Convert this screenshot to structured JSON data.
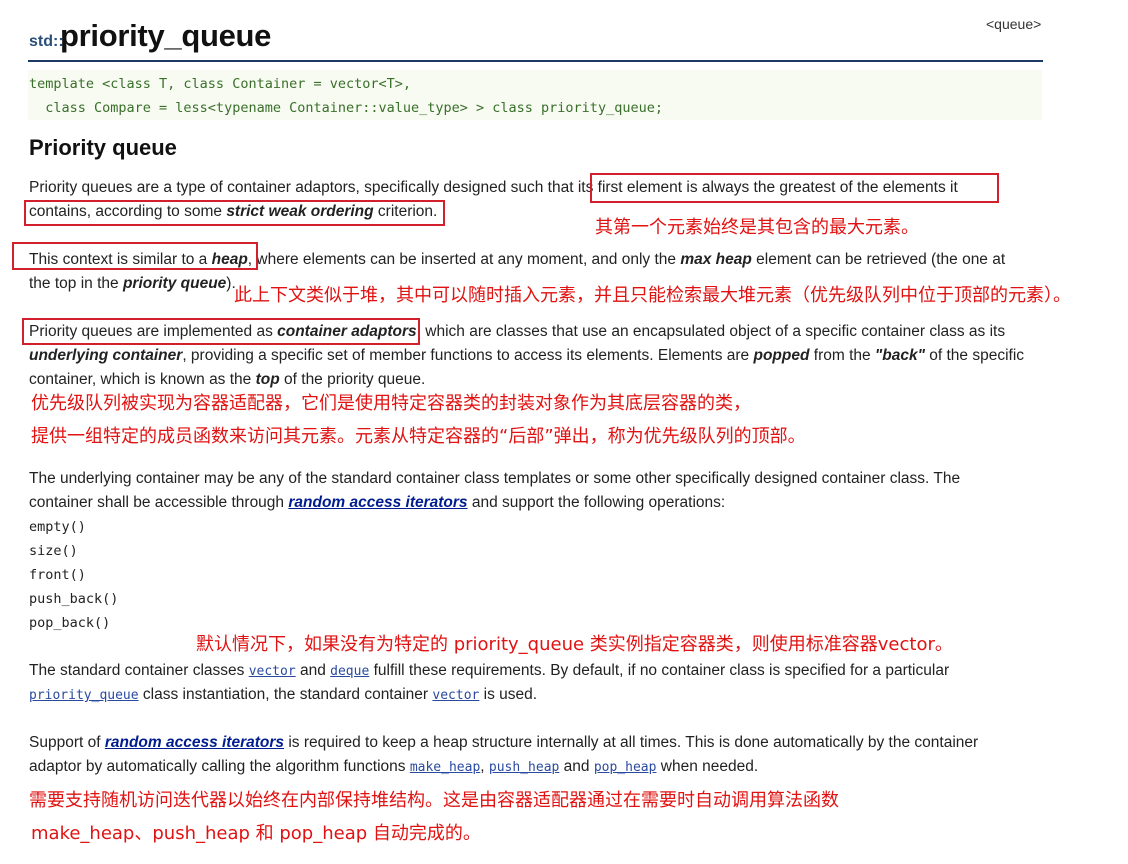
{
  "header": {
    "namespace": "std::",
    "title": "priority_queue",
    "library": "<queue>"
  },
  "code": {
    "line1": "template <class T, class Container = vector<T>,",
    "line2": "  class Compare = less<typename Container::value_type> > class priority_queue;"
  },
  "section_title": "Priority queue",
  "p1": {
    "a": "Priority queues are a type of container adaptors, specifically designed such that ",
    "b": "its first element is always the greatest of the elements it",
    "c": "contains, according to some ",
    "d": "strict weak ordering",
    "e": " criterion."
  },
  "cn1": "其第一个元素始终是其包含的最大元素。",
  "p2": {
    "a": "This context is similar to a ",
    "b": "heap",
    "c": ", where elements can be inserted at any moment, and only the ",
    "d": "max heap",
    "e": " element can be retrieved (the one at",
    "f": "the top in the ",
    "g": "priority queue",
    "h": ")."
  },
  "cn2": "此上下文类似于堆，其中可以随时插入元素，并且只能检索最大堆元素（优先级队列中位于顶部的元素）。",
  "p3": {
    "a": "Priority queues are implemented as ",
    "b": "container adaptors",
    "c": ", which are classes that use an encapsulated object of a specific container class as its",
    "d": "underlying container",
    "e": ", providing a specific set of member functions to access its elements. Elements are ",
    "f": "popped",
    "g": " from the ",
    "h": "\"back\"",
    "i": " of the specific",
    "j": "container, which is known as the ",
    "k": "top",
    "l": " of the priority queue."
  },
  "cn3a": "优先级队列被实现为容器适配器，它们是使用特定容器类的封装对象作为其底层容器的类，",
  "cn3b": "提供一组特定的成员函数来访问其元素。元素从特定容器的“后部”弹出，称为优先级队列的顶部。",
  "p4": {
    "a": "The underlying container may be any of the standard container class templates or some other specifically designed container class. The",
    "b": "container shall be accessible through ",
    "link": "random access iterators",
    "c": " and support the following operations:"
  },
  "ops": [
    "empty()",
    "size()",
    "front()",
    "push_back()",
    "pop_back()"
  ],
  "cn4": "默认情况下，如果没有为特定的 priority_queue 类实例指定容器类，则使用标准容器vector。",
  "p5": {
    "a": "The standard container classes ",
    "vector": "vector",
    "b": " and ",
    "deque": "deque",
    "c": " fulfill these requirements. By default, if no container class is specified for a particular",
    "pq": "priority_queue",
    "d": " class instantiation, the standard container ",
    "vector2": "vector",
    "e": " is used."
  },
  "p6": {
    "a": "Support of ",
    "link": "random access iterators",
    "b": " is required to keep a heap structure internally at all times. This is done automatically by the container",
    "c": "adaptor by automatically calling the algorithm functions ",
    "make": "make_heap",
    "sep": ", ",
    "push": "push_heap",
    "and": " and ",
    "pop": "pop_heap",
    "d": " when needed."
  },
  "cn5a": "需要支持随机访问迭代器以始终在内部保持堆结构。这是由容器适配器通过在需要时自动调用算法函数",
  "cn5b": "make_heap、push_heap 和 pop_heap 自动完成的。",
  "colors": {
    "annotation_red": "#e11212",
    "box_red": "#d2202c",
    "link_blue": "#001d8f",
    "code_green": "#3a6f2a",
    "code_bg": "#f7fbf2"
  }
}
